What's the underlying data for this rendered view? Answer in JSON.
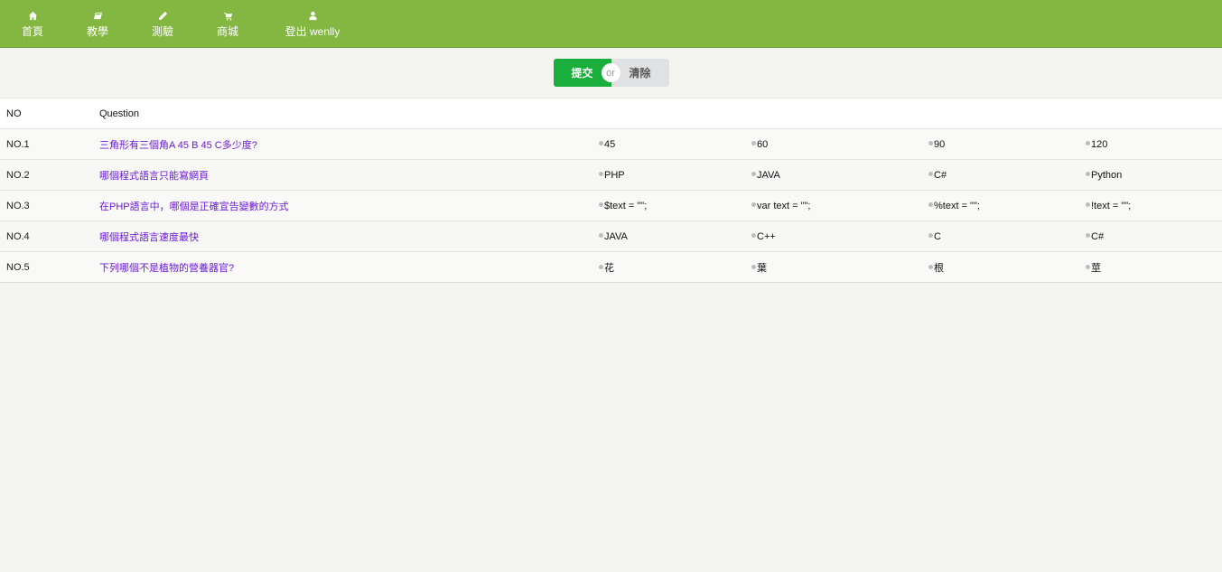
{
  "nav": [
    {
      "icon": "home-icon",
      "label": "首頁"
    },
    {
      "icon": "book-icon",
      "label": "教學"
    },
    {
      "icon": "pencil-icon",
      "label": "測驗"
    },
    {
      "icon": "cart-icon",
      "label": "商城"
    },
    {
      "icon": "user-icon",
      "label": "登出 wenlly"
    }
  ],
  "actions": {
    "submit": "提交",
    "or": "or",
    "clear": "清除"
  },
  "table": {
    "headers": {
      "no": "NO",
      "question": "Question"
    },
    "rows": [
      {
        "no": "NO.1",
        "question": "三角形有三個角A 45 B 45 C多少度?",
        "options": [
          "45",
          "60",
          "90",
          "120"
        ]
      },
      {
        "no": "NO.2",
        "question": "哪個程式語言只能寫網頁",
        "options": [
          "PHP",
          "JAVA",
          "C#",
          "Python"
        ]
      },
      {
        "no": "NO.3",
        "question": "在PHP語言中，哪個是正確宣告變數的方式",
        "options": [
          "$text = \"\";",
          "var text = \"\";",
          "%text = \"\";",
          "!text = \"\";"
        ]
      },
      {
        "no": "NO.4",
        "question": "哪個程式語言速度最快",
        "options": [
          "JAVA",
          "C++",
          "C",
          "C#"
        ]
      },
      {
        "no": "NO.5",
        "question": "下列哪個不是植物的營養器官?",
        "options": [
          "花",
          "葉",
          "根",
          "莖"
        ]
      }
    ]
  },
  "colors": {
    "topbar": "#84b741",
    "submit": "#1aaf3c",
    "question_link": "#6a1ad8"
  }
}
